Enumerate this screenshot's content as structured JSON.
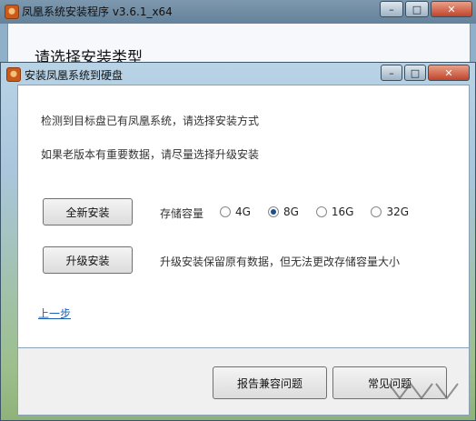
{
  "outer_window": {
    "title": "凤凰系统安装程序 v3.6.1_x64",
    "heading": "请选择安装类型",
    "controls": {
      "minimize": "–",
      "maximize": "□",
      "close": "✕"
    }
  },
  "dialog": {
    "title": "安装凤凰系统到硬盘",
    "controls": {
      "minimize": "–",
      "maximize": "□",
      "close": "✕"
    },
    "info_line1": "检测到目标盘已有凤凰系统，请选择安装方式",
    "info_line2": "如果老版本有重要数据，请尽量选择升级安装",
    "new_install_button": "全新安装",
    "storage_label": "存储容量",
    "storage_options": [
      "4G",
      "8G",
      "16G",
      "32G"
    ],
    "storage_selected": "8G",
    "upgrade_button": "升级安装",
    "upgrade_note": "升级安装保留原有数据，但无法更改存储容量大小",
    "back_link": "上一步",
    "report_button": "报告兼容问题",
    "feedback_button": "常见问题"
  }
}
